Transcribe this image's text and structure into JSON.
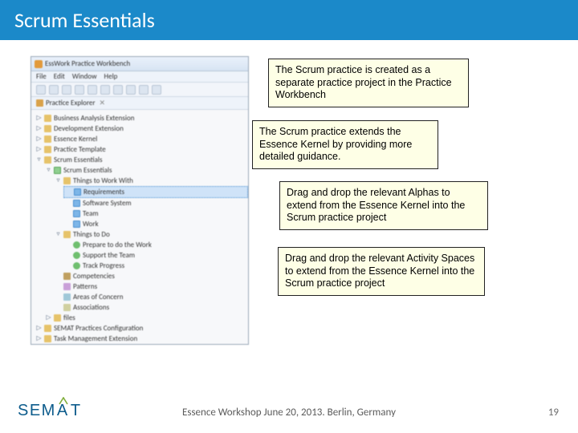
{
  "title": "Scrum Essentials",
  "app": {
    "window_title": "EssWork Practice Workbench",
    "menu": [
      "File",
      "Edit",
      "Window",
      "Help"
    ],
    "pane_tab": "Practice Explorer",
    "tree": {
      "root_items": [
        "Business Analysis Extension",
        "Development Extension",
        "Essence Kernel",
        "Practice Template",
        "Scrum Essentials"
      ],
      "scrum_root": "Scrum Essentials",
      "ttw_label": "Things to Work With",
      "ttw_items": [
        "Requirements",
        "Software System",
        "Team",
        "Work"
      ],
      "ttd_label": "Things to Do",
      "ttd_items": [
        "Prepare to do the Work",
        "Support the Team",
        "Track Progress"
      ],
      "other_items": [
        "Competencies",
        "Patterns",
        "Areas of Concern",
        "Associations"
      ],
      "files_label": "files",
      "tail_items": [
        "SEMAT Practices Configuration",
        "Task Management Extension"
      ]
    }
  },
  "callouts": {
    "c1": "The Scrum practice is created as a separate practice project in the Practice Workbench",
    "c2": "The Scrum practice extends the Essence Kernel by providing more detailed guidance.",
    "c3": "Drag and drop the relevant Alphas to extend from the Essence Kernel into the Scrum practice project",
    "c4": "Drag and drop the relevant Activity Spaces to extend from the Essence Kernel into the Scrum practice project"
  },
  "footer": {
    "logo_left": "SEM",
    "logo_right": "T",
    "text": "Essence Workshop June 20, 2013. Berlin, Germany",
    "page": "19"
  }
}
